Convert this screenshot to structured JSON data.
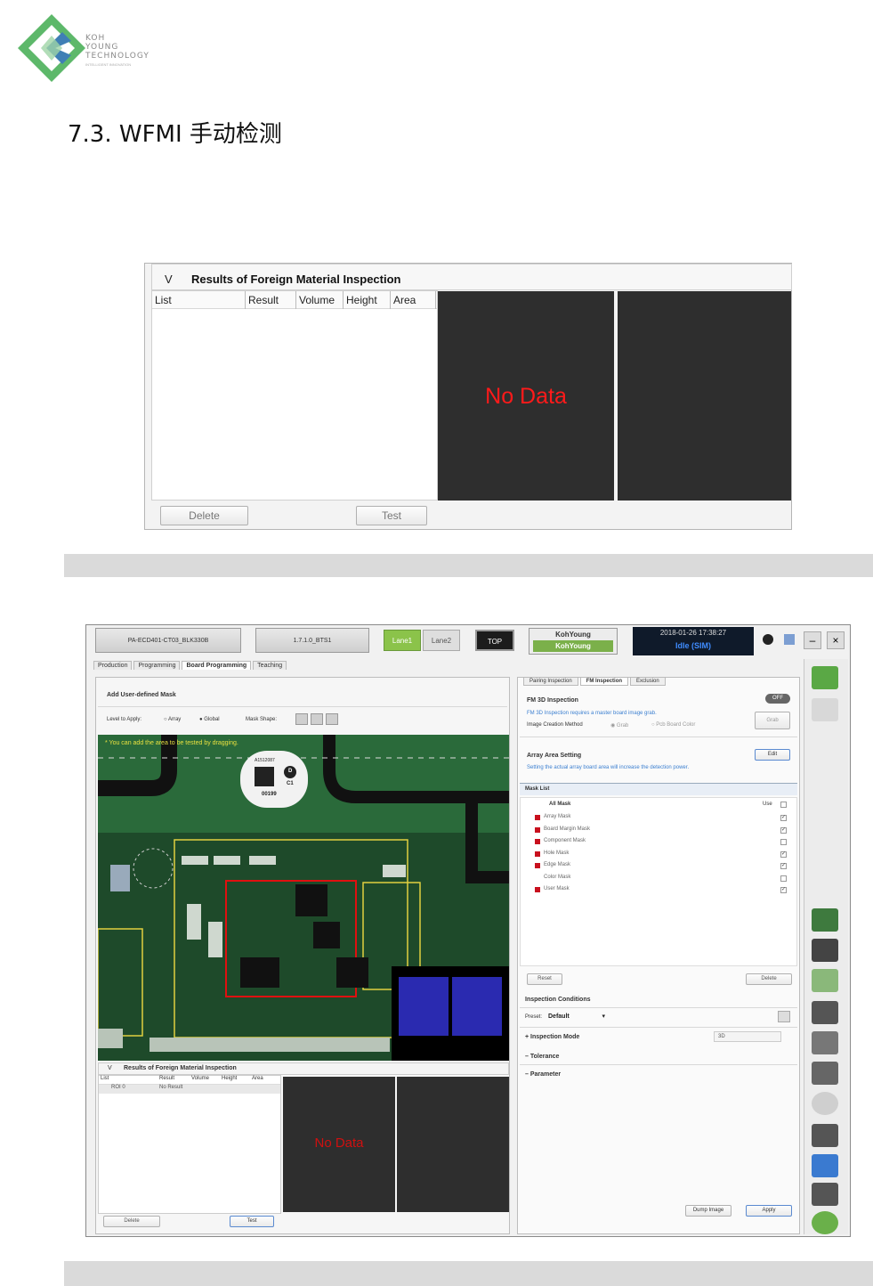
{
  "logo": {
    "line1": "KOH",
    "line2": "YOUNG",
    "line3": "TECHNOLOGY",
    "tagline": "INTELLIGENT INNOVATION"
  },
  "section_title": "7.3. WFMI 手动检测",
  "fm_panel": {
    "collapse_glyph": "V",
    "title": "Results of Foreign Material Inspection",
    "columns": [
      "List",
      "Result",
      "Volume",
      "Height",
      "Area"
    ],
    "no_data": "No Data",
    "delete_label": "Delete",
    "test_label": "Test"
  },
  "app": {
    "job_name": "PA-ECD401-CT03_BLK330B",
    "version": "1.7.1.0_BTS1",
    "lane1": "Lane1",
    "lane2": "Lane2",
    "top_label": "TOP",
    "company_1": "KohYoung",
    "company_2": "KohYoung",
    "datetime": "2018-01-26 17:38:27",
    "status": "Idle (SIM)",
    "min_glyph": "–",
    "close_glyph": "×",
    "tabs": [
      "Production",
      "Programming",
      "Board Programming",
      "Teaching"
    ],
    "left": {
      "header": "Add User-defined Mask",
      "level_label": "Level to Apply:",
      "opt_array": "Array",
      "opt_global": "Global",
      "mask_shape_label": "Mask Shape:",
      "hint": "* You can add the area to be tested by dragging.",
      "label_code": "A1512087",
      "label_d": "D",
      "label_c1": "C1",
      "label_num": "00199",
      "results_title": "Results of Foreign Material Inspection",
      "columns": [
        "List",
        "Result",
        "Volume",
        "Height",
        "Area"
      ],
      "row": {
        "list": "ROI 0",
        "result": "No Result"
      },
      "no_data": "No Data",
      "delete_label": "Delete",
      "test_label": "Test"
    },
    "right": {
      "tabs": [
        "Pairing Inspection",
        "FM Inspection",
        "Exclusion"
      ],
      "fm3d_title": "FM 3D Inspection",
      "fm3d_toggle": "OFF",
      "fm3d_note": "FM 3D Inspection requires a master board image grab.",
      "image_method_label": "Image Creation Method",
      "opt_grab": "Grab",
      "opt_pcb": "Pcb Board Color",
      "grab_btn": "Grab",
      "array_title": "Array Area Setting",
      "edit_btn": "Edit",
      "array_note": "Setting the actual array board area will increase the detection power.",
      "mask_list_title": "Mask List",
      "all_mask": "All Mask",
      "use_label": "Use",
      "masks": [
        {
          "name": "Array Mask",
          "red": true,
          "use": true
        },
        {
          "name": "Board Margin Mask",
          "red": true,
          "use": true
        },
        {
          "name": "Component Mask",
          "red": true,
          "use": false
        },
        {
          "name": "Hole Mask",
          "red": true,
          "use": true
        },
        {
          "name": "Edge Mask",
          "red": true,
          "use": true
        },
        {
          "name": "Color Mask",
          "red": false,
          "use": false
        },
        {
          "name": "User Mask",
          "red": true,
          "use": true
        }
      ],
      "reset_btn": "Reset",
      "delete_btn": "Delete",
      "conditions_title": "Inspection Conditions",
      "preset_label": "Preset:",
      "preset_value": "Default",
      "inspection_mode": "Inspection Mode",
      "mode_value": "3D",
      "tolerance": "Tolerance",
      "parameter": "Parameter",
      "dump_btn": "Dump Image",
      "apply_btn": "Apply"
    }
  }
}
